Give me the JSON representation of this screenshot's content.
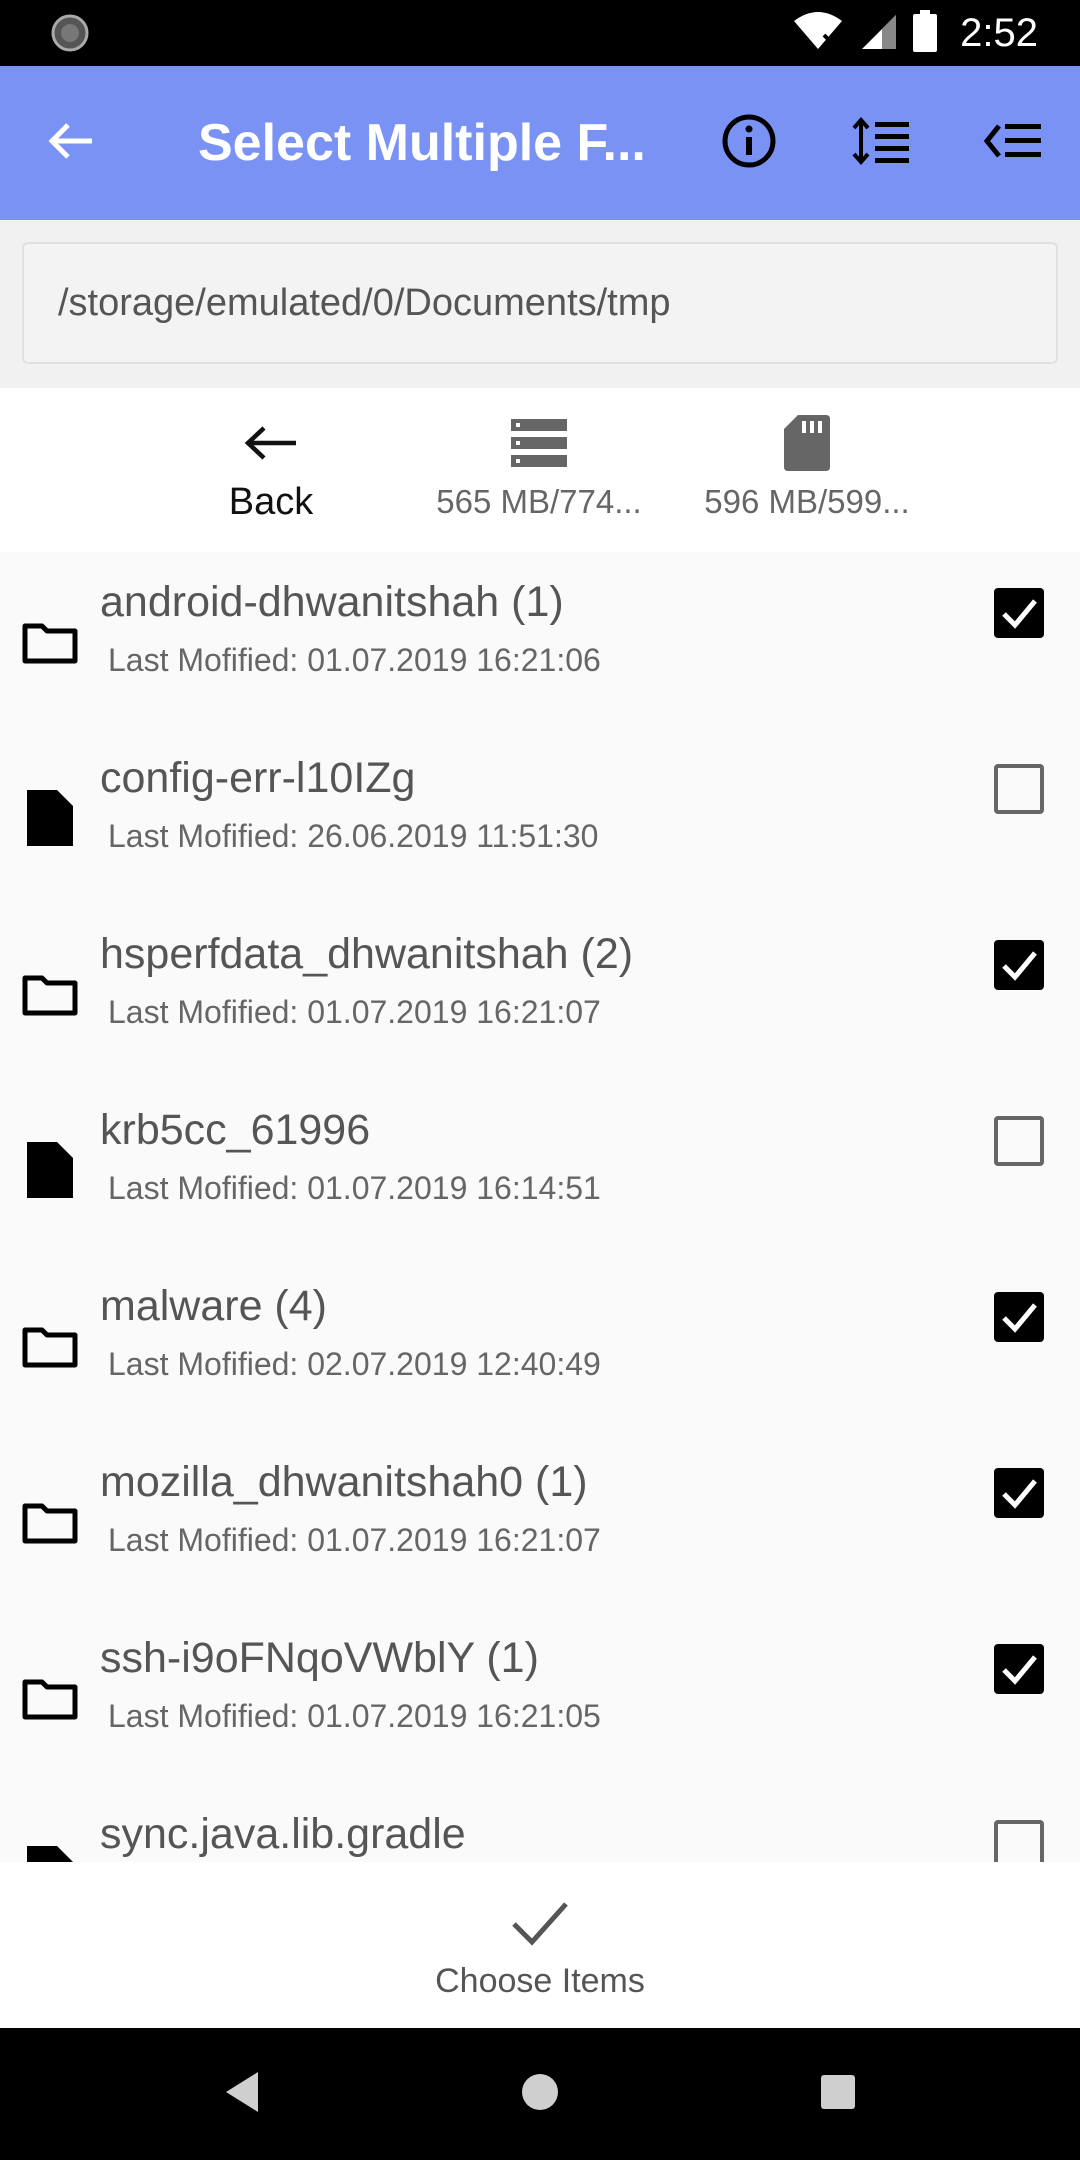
{
  "status_bar": {
    "time": "2:52"
  },
  "app_bar": {
    "title": "Select Multiple F...",
    "back_icon": "arrow-left-icon",
    "actions": [
      "info-icon",
      "sort-icon",
      "filter-icon"
    ]
  },
  "path": {
    "value": "/storage/emulated/0/Documents/tmp"
  },
  "storage": [
    {
      "label": "Back",
      "icon": "arrow-left-icon"
    },
    {
      "label": "565 MB/774...",
      "icon": "storage-icon"
    },
    {
      "label": "596 MB/599...",
      "icon": "sd-card-icon"
    }
  ],
  "files": [
    {
      "name": "android-dhwanitshah (1)",
      "modified": "Last Mofified: 01.07.2019 16:21:06",
      "type": "folder",
      "checked": true
    },
    {
      "name": "config-err-l10IZg",
      "modified": "Last Mofified: 26.06.2019 11:51:30",
      "type": "file",
      "checked": false
    },
    {
      "name": "hsperfdata_dhwanitshah (2)",
      "modified": "Last Mofified: 01.07.2019 16:21:07",
      "type": "folder",
      "checked": true
    },
    {
      "name": "krb5cc_61996",
      "modified": "Last Mofified: 01.07.2019 16:14:51",
      "type": "file",
      "checked": false
    },
    {
      "name": "malware (4)",
      "modified": "Last Mofified: 02.07.2019 12:40:49",
      "type": "folder",
      "checked": true
    },
    {
      "name": "mozilla_dhwanitshah0 (1)",
      "modified": "Last Mofified: 01.07.2019 16:21:07",
      "type": "folder",
      "checked": true
    },
    {
      "name": "ssh-i9oFNqoVWblY (1)",
      "modified": "Last Mofified: 01.07.2019 16:21:05",
      "type": "folder",
      "checked": true
    },
    {
      "name": "sync.java.lib.gradle",
      "modified": "",
      "type": "file",
      "checked": false
    }
  ],
  "bottom_action": {
    "label": "Choose Items"
  },
  "colors": {
    "app_bar": "#7b92f5",
    "status_bar": "#000000",
    "nav_bar": "#000000"
  }
}
